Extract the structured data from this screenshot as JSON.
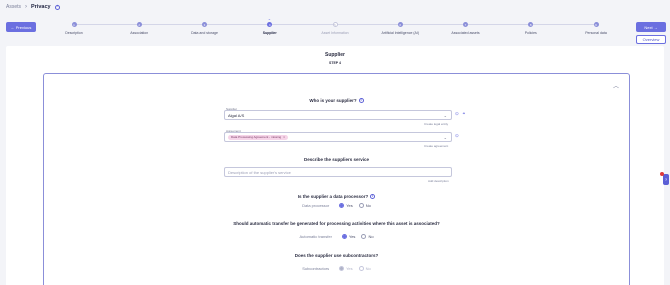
{
  "breadcrumb": {
    "parent": "Assets",
    "separator": "›",
    "current": "Privacy",
    "info": "i"
  },
  "buttons": {
    "previous": "← Previous",
    "next": "Next →",
    "overview": "Overview"
  },
  "stepper": {
    "steps": [
      {
        "number": "1",
        "label": "Description",
        "state": "done"
      },
      {
        "number": "2",
        "label": "Association",
        "state": "done"
      },
      {
        "number": "3",
        "label": "Data and storage",
        "state": "done"
      },
      {
        "number": "4",
        "label": "Supplier",
        "state": "current"
      },
      {
        "number": "5",
        "label": "Asset Information",
        "state": "inactive"
      },
      {
        "number": "6",
        "label": "Artificial Intelligence (AI)",
        "state": "done"
      },
      {
        "number": "7",
        "label": "Associated assets",
        "state": "done"
      },
      {
        "number": "8",
        "label": "Policies",
        "state": "done"
      },
      {
        "number": "9",
        "label": "Personal data",
        "state": "done"
      }
    ]
  },
  "panel": {
    "title": "Supplier",
    "subtitle": "STEP 4"
  },
  "supplier": {
    "question": "Who is your supplier?",
    "field_label": "Supplier",
    "value": "Algal A/S",
    "create_link": "Create legal entity"
  },
  "agreement": {
    "field_label": "Agreement",
    "chip": "Data Processing Agreement - missing",
    "create_link": "Create agreement"
  },
  "service": {
    "question": "Describe the suppliers service",
    "placeholder": "Description of the supplier's service",
    "add_link": "Add description"
  },
  "data_processor": {
    "question": "Is the supplier a data processor?",
    "row_label": "Data processor",
    "yes": "Yes",
    "no": "No",
    "selected": "Yes"
  },
  "transfer": {
    "question": "Should automatic transfer be generated for processing activities where this asset is associated?",
    "row_label": "Automatic transfer",
    "yes": "Yes",
    "no": "No",
    "selected": "Yes"
  },
  "subcontractors": {
    "question": "Does the supplier use subcontractors?",
    "row_label": "Subcontractors",
    "yes": "Yes",
    "no": "No",
    "selected": "Yes"
  },
  "icons": {
    "info": "info-icon",
    "collapse": "chevron-up-icon",
    "dropdown": "chevron-down-icon",
    "link": "link-icon",
    "settings": "settings-icon",
    "help": "help-icon"
  },
  "colors": {
    "accent": "#6b6fe0",
    "chip_bg": "#f6d4e8",
    "background": "#f3f4f8"
  }
}
